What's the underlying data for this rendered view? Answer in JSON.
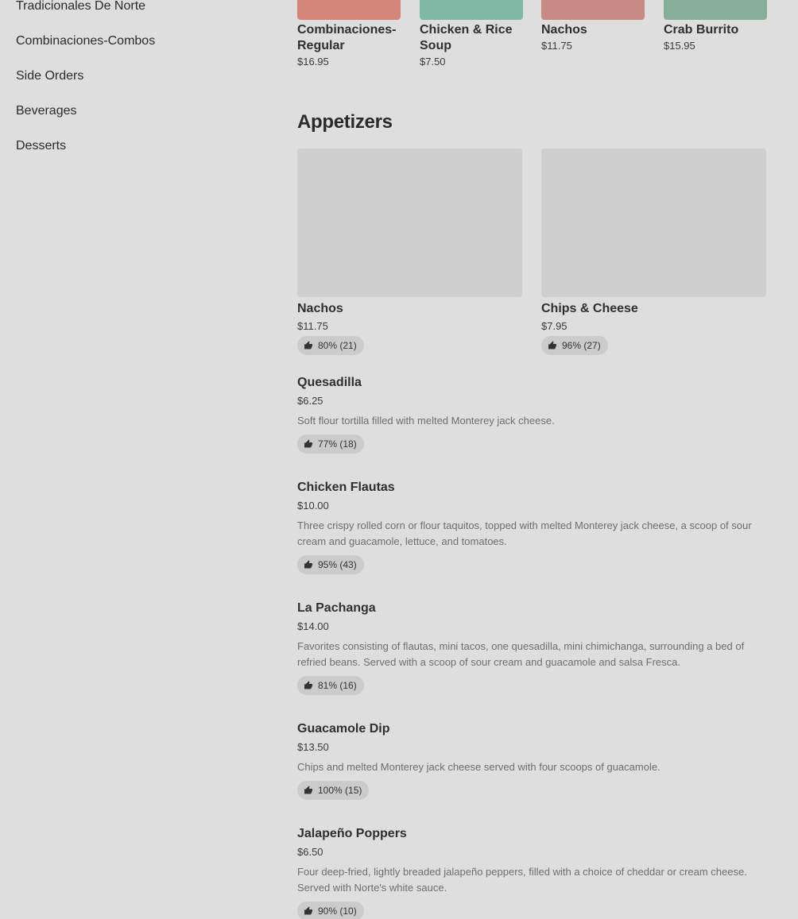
{
  "sidebar": {
    "items": [
      {
        "label": "Tradicionales De Norte"
      },
      {
        "label": "Combinaciones-Combos"
      },
      {
        "label": "Side Orders"
      },
      {
        "label": "Beverages"
      },
      {
        "label": "Desserts"
      }
    ]
  },
  "carousel": [
    {
      "name": "Combinaciones-Regular",
      "price": "$16.95",
      "color": "#d38579"
    },
    {
      "name": "Chicken & Rice Soup",
      "price": "$7.50",
      "color": "#7fb8a4"
    },
    {
      "name": "Nachos",
      "price": "$11.75",
      "color": "#c88a84"
    },
    {
      "name": "Crab Burrito",
      "price": "$15.95",
      "color": "#86ad96"
    }
  ],
  "section": {
    "title": "Appetizers"
  },
  "featured": [
    {
      "name": "Nachos",
      "price": "$11.75",
      "rating": "80% (21)"
    },
    {
      "name": "Chips & Cheese",
      "price": "$7.95",
      "rating": "96% (27)"
    }
  ],
  "items": [
    {
      "name": "Quesadilla",
      "price": "$6.25",
      "desc": "Soft flour tortilla filled with melted Monterey jack cheese.",
      "rating": "77% (18)"
    },
    {
      "name": "Chicken Flautas",
      "price": "$10.00",
      "desc": "Three crispy rolled corn or flour taquitos, topped with melted Monterey jack cheese, a scoop of sour cream and guacamole, lettuce, and tomatoes.",
      "rating": "95% (43)"
    },
    {
      "name": "La Pachanga",
      "price": "$14.00",
      "desc": "Favorites consisting of flautas, mini tacos, one quesadilla, mini chimichanga, surrounding a bed of refried beans. Served with a scoop of sour cream and guacamole and salsa Fresca.",
      "rating": "81% (16)"
    },
    {
      "name": "Guacamole Dip",
      "price": "$13.50",
      "desc": "Chips and melted Monterey jack cheese served with four scoops of guacamole.",
      "rating": "100% (15)"
    },
    {
      "name": "Jalapeño Poppers",
      "price": "$6.50",
      "desc": "Four deep-fried, lightly breaded jalapeño peppers, filled with a choice of cheddar or cream cheese. Served with Norte's white sauce.",
      "rating": "90% (10)"
    }
  ]
}
